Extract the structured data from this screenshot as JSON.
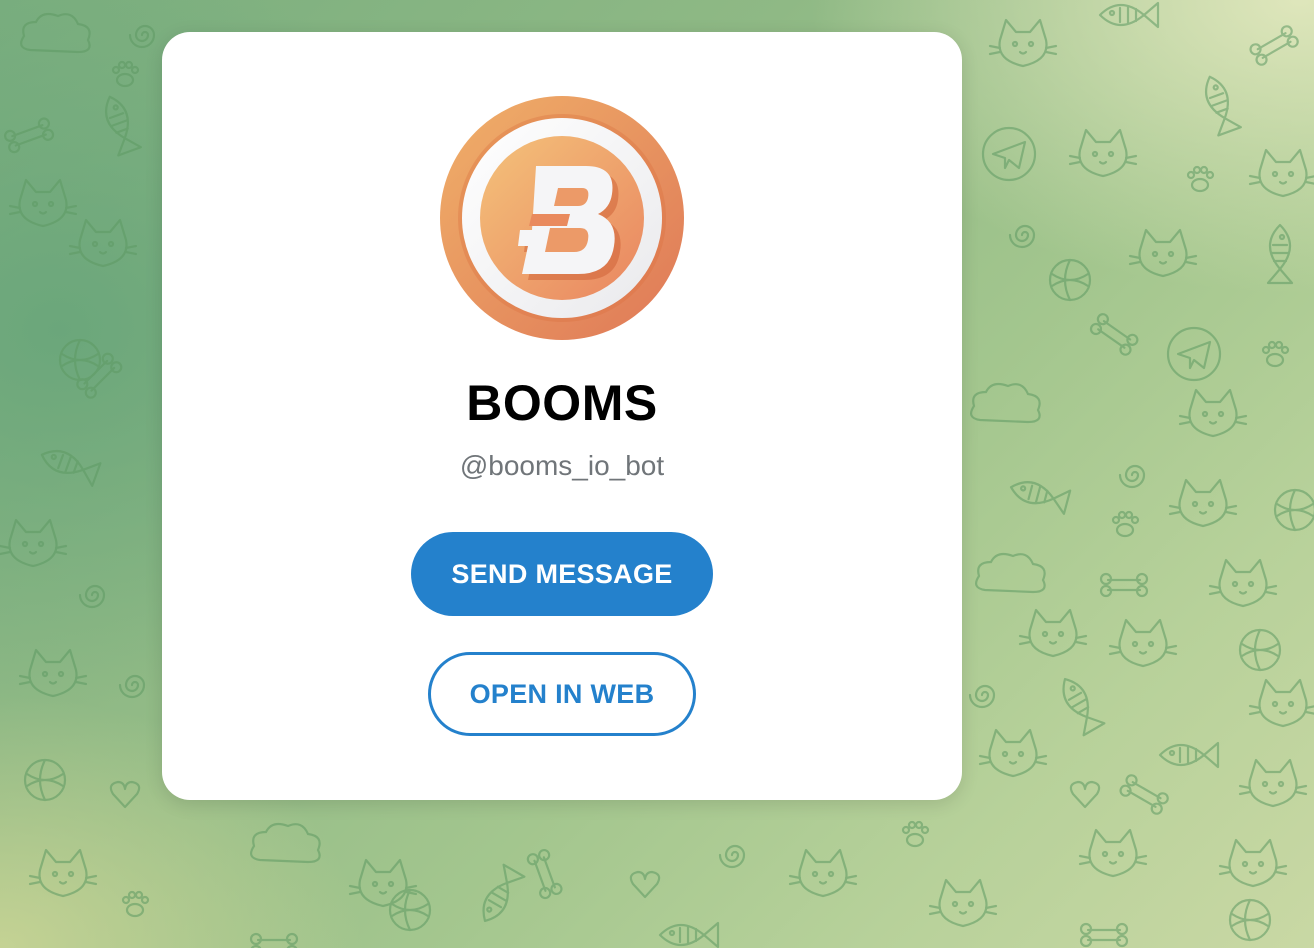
{
  "bot": {
    "name": "BOOMS",
    "username": "@booms_io_bot",
    "avatar_icon": "booms-b-coin-icon"
  },
  "actions": {
    "send_message_label": "SEND MESSAGE",
    "open_in_web_label": "OPEN IN WEB"
  },
  "colors": {
    "accent": "#2481cc",
    "background": "#8fb985",
    "coin_outer": "#e8855e",
    "coin_inner": "#f0b070"
  }
}
